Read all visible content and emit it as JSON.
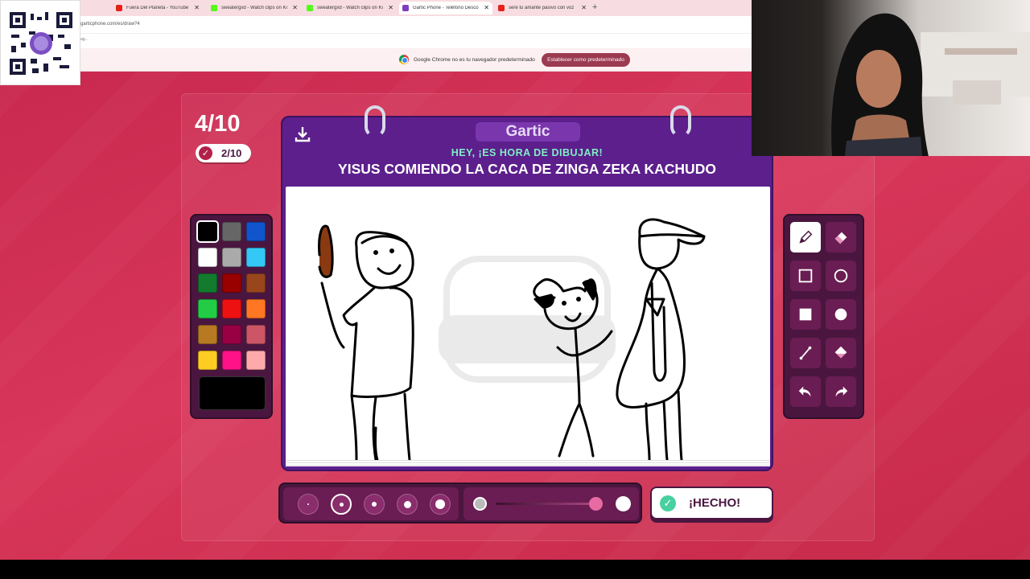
{
  "browser": {
    "tabs": [
      {
        "title": "Fuera Del Planeta - YouTube",
        "favicon_color": "#e62117"
      },
      {
        "title": "sweatergxd - Watch clips on Ki",
        "favicon_color": "#53fc18"
      },
      {
        "title": "sweatergxd - Watch clips on Ki",
        "favicon_color": "#53fc18"
      },
      {
        "title": "Gartic Phone - Teléfono Desco",
        "favicon_color": "#7b3fc4"
      },
      {
        "title": "sere tu amante pasivo con voz",
        "favicon_color": "#e62117"
      }
    ],
    "new_tab_symbol": "+",
    "url": "garticphone.com/es/draw?4",
    "bookmark_text": "ag...",
    "infobar_text": "Google Chrome no es tu navegador predeterminado",
    "infobar_button": "Establecer como predeterminado"
  },
  "game": {
    "round": "4/10",
    "score": "2/10",
    "logo": "Gartic",
    "prompt_title": "HEY, ¡ES HORA DE DIBUJAR!",
    "prompt_text": "YISUS COMIENDO LA CACA DE ZINGA ZEKA KACHUDO",
    "done_label": "¡HECHO!",
    "palette": [
      "#000000",
      "#666666",
      "#1155cc",
      "#ffffff",
      "#aaaaaa",
      "#33c8f5",
      "#127b2e",
      "#990000",
      "#99461c",
      "#22cc44",
      "#ee1111",
      "#ff7722",
      "#b77a22",
      "#990044",
      "#cc5566",
      "#ffcc22",
      "#ff1188",
      "#ffaaaa"
    ],
    "selected_color": "#000000",
    "tools": [
      "pencil-icon",
      "eraser-icon",
      "rectangle-outline-icon",
      "circle-outline-icon",
      "rectangle-fill-icon",
      "circle-fill-icon",
      "line-icon",
      "bucket-icon",
      "undo-icon",
      "redo-icon"
    ],
    "selected_tool": "pencil-icon",
    "brush_sizes": 5,
    "selected_brush_size_index": 1,
    "opacity_fraction": 0.95,
    "colors": {
      "background": "#d8365a",
      "panel_dark": "#4a1640",
      "card_purple": "#5c1f8c",
      "prompt_green": "#7ff0c4"
    }
  }
}
